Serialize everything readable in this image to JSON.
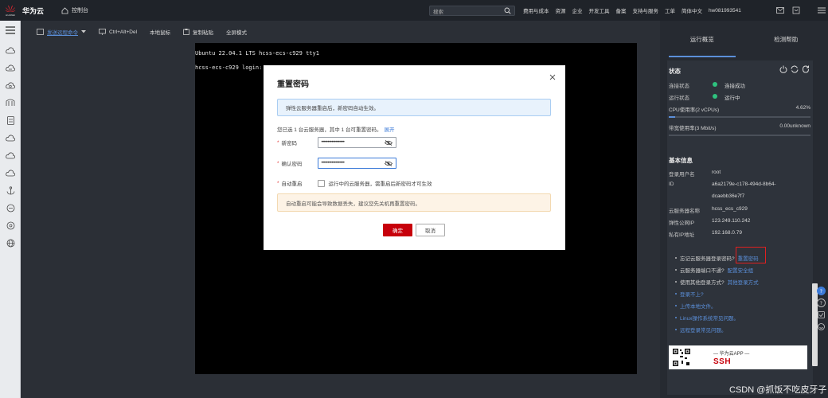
{
  "topbar": {
    "logo_text": "HUAWEI",
    "brand": "华为云",
    "console": "控制台",
    "search_placeholder": "搜索",
    "nav": [
      "费用与成本",
      "资源",
      "企业",
      "开发工具",
      "备案",
      "支持与服务",
      "工单",
      "简体中文",
      "hw081993541"
    ]
  },
  "toolbar": {
    "send_remote": "发送远程命令",
    "ctrl_alt_del": "Ctrl+Alt+Del",
    "local_mouse": "本地鼠标",
    "copy_paste": "复制粘贴",
    "fullscreen": "全屏模式"
  },
  "terminal": {
    "line1": "Ubuntu 22.04.1 LTS hcss-ecs-c929 tty1",
    "line2": "hcss-ecs-c929 login:"
  },
  "dialog": {
    "title": "重置密码",
    "info": "弹性云服务器重启后，新密码自动生效。",
    "selected_text": "您已选 1 台云服务器，其中 1 台可重置密码。",
    "expand": "展开",
    "new_pwd_label": "新密码",
    "new_pwd_value": "••••••••••••••••••",
    "confirm_pwd_label": "确认密码",
    "confirm_pwd_value": "••••••••••••••••••",
    "auto_restart_label": "自动重启",
    "auto_restart_text": "运行中的云服务器，需重启后新密码才可生效",
    "warning": "自动重启可能会导致数据丢失，建议您先关机再重置密码。",
    "ok": "确定",
    "cancel": "取消"
  },
  "panel": {
    "tabs": [
      "运行概览",
      "检测帮助"
    ],
    "status_title": "状态",
    "conn_label": "连接状态",
    "conn_value": "连接成功",
    "run_label": "运行状态",
    "run_value": "运行中",
    "cpu_label": "CPU使用率(2 vCPUs)",
    "cpu_value": "4.62%",
    "cpu_fraction": 0.0462,
    "bw_label": "带宽使用率(3 Mbit/s)",
    "bw_value": "0.00unknown",
    "bw_fraction": 0,
    "basic_title": "基本信息",
    "user_label": "登录用户名",
    "user_value": "root",
    "id_label": "ID",
    "id_value1": "a6a2179e-c178-494d-8b64-",
    "id_value2": "dcaebb36e7f7",
    "name_label": "云服务器名称",
    "name_value": "hcss_ecs_c929",
    "eip_label": "弹性公网IP",
    "eip_value": "123.249.110.242",
    "pip_label": "私有IP地址",
    "pip_value": "192.168.0.79",
    "forgot_text": "忘记云服务器登录密码?",
    "forgot_link": "重置密码",
    "port_text": "云服务器端口不通?",
    "port_link": "配置安全组",
    "other_text": "使用其他登录方式?",
    "other_link": "其他登录方式",
    "cant_login": "登录不上?",
    "upload": "上传本地文件。",
    "linux_faq": "Linux操作系统常见问题。",
    "remote_faq": "远程登录常见问题。",
    "banner_small": "— 华为云APP —",
    "banner_big": "   SSH"
  },
  "watermark": "CSDN @抓饭不吃皮牙子",
  "colors": {
    "brand_red": "#c7000b",
    "link_blue": "#3b7ad8",
    "status_green": "#2ec27e",
    "highlight_red": "#e02020"
  }
}
